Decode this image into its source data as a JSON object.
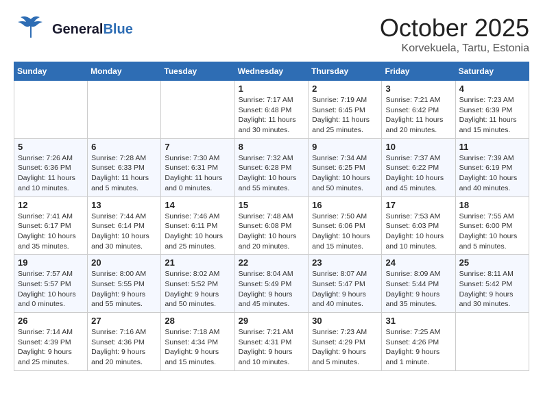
{
  "header": {
    "logo_general": "General",
    "logo_blue": "Blue",
    "month": "October 2025",
    "location": "Korvekuela, Tartu, Estonia"
  },
  "weekdays": [
    "Sunday",
    "Monday",
    "Tuesday",
    "Wednesday",
    "Thursday",
    "Friday",
    "Saturday"
  ],
  "weeks": [
    [
      {
        "day": "",
        "info": ""
      },
      {
        "day": "",
        "info": ""
      },
      {
        "day": "",
        "info": ""
      },
      {
        "day": "1",
        "info": "Sunrise: 7:17 AM\nSunset: 6:48 PM\nDaylight: 11 hours\nand 30 minutes."
      },
      {
        "day": "2",
        "info": "Sunrise: 7:19 AM\nSunset: 6:45 PM\nDaylight: 11 hours\nand 25 minutes."
      },
      {
        "day": "3",
        "info": "Sunrise: 7:21 AM\nSunset: 6:42 PM\nDaylight: 11 hours\nand 20 minutes."
      },
      {
        "day": "4",
        "info": "Sunrise: 7:23 AM\nSunset: 6:39 PM\nDaylight: 11 hours\nand 15 minutes."
      }
    ],
    [
      {
        "day": "5",
        "info": "Sunrise: 7:26 AM\nSunset: 6:36 PM\nDaylight: 11 hours\nand 10 minutes."
      },
      {
        "day": "6",
        "info": "Sunrise: 7:28 AM\nSunset: 6:33 PM\nDaylight: 11 hours\nand 5 minutes."
      },
      {
        "day": "7",
        "info": "Sunrise: 7:30 AM\nSunset: 6:31 PM\nDaylight: 11 hours\nand 0 minutes."
      },
      {
        "day": "8",
        "info": "Sunrise: 7:32 AM\nSunset: 6:28 PM\nDaylight: 10 hours\nand 55 minutes."
      },
      {
        "day": "9",
        "info": "Sunrise: 7:34 AM\nSunset: 6:25 PM\nDaylight: 10 hours\nand 50 minutes."
      },
      {
        "day": "10",
        "info": "Sunrise: 7:37 AM\nSunset: 6:22 PM\nDaylight: 10 hours\nand 45 minutes."
      },
      {
        "day": "11",
        "info": "Sunrise: 7:39 AM\nSunset: 6:19 PM\nDaylight: 10 hours\nand 40 minutes."
      }
    ],
    [
      {
        "day": "12",
        "info": "Sunrise: 7:41 AM\nSunset: 6:17 PM\nDaylight: 10 hours\nand 35 minutes."
      },
      {
        "day": "13",
        "info": "Sunrise: 7:44 AM\nSunset: 6:14 PM\nDaylight: 10 hours\nand 30 minutes."
      },
      {
        "day": "14",
        "info": "Sunrise: 7:46 AM\nSunset: 6:11 PM\nDaylight: 10 hours\nand 25 minutes."
      },
      {
        "day": "15",
        "info": "Sunrise: 7:48 AM\nSunset: 6:08 PM\nDaylight: 10 hours\nand 20 minutes."
      },
      {
        "day": "16",
        "info": "Sunrise: 7:50 AM\nSunset: 6:06 PM\nDaylight: 10 hours\nand 15 minutes."
      },
      {
        "day": "17",
        "info": "Sunrise: 7:53 AM\nSunset: 6:03 PM\nDaylight: 10 hours\nand 10 minutes."
      },
      {
        "day": "18",
        "info": "Sunrise: 7:55 AM\nSunset: 6:00 PM\nDaylight: 10 hours\nand 5 minutes."
      }
    ],
    [
      {
        "day": "19",
        "info": "Sunrise: 7:57 AM\nSunset: 5:57 PM\nDaylight: 10 hours\nand 0 minutes."
      },
      {
        "day": "20",
        "info": "Sunrise: 8:00 AM\nSunset: 5:55 PM\nDaylight: 9 hours\nand 55 minutes."
      },
      {
        "day": "21",
        "info": "Sunrise: 8:02 AM\nSunset: 5:52 PM\nDaylight: 9 hours\nand 50 minutes."
      },
      {
        "day": "22",
        "info": "Sunrise: 8:04 AM\nSunset: 5:49 PM\nDaylight: 9 hours\nand 45 minutes."
      },
      {
        "day": "23",
        "info": "Sunrise: 8:07 AM\nSunset: 5:47 PM\nDaylight: 9 hours\nand 40 minutes."
      },
      {
        "day": "24",
        "info": "Sunrise: 8:09 AM\nSunset: 5:44 PM\nDaylight: 9 hours\nand 35 minutes."
      },
      {
        "day": "25",
        "info": "Sunrise: 8:11 AM\nSunset: 5:42 PM\nDaylight: 9 hours\nand 30 minutes."
      }
    ],
    [
      {
        "day": "26",
        "info": "Sunrise: 7:14 AM\nSunset: 4:39 PM\nDaylight: 9 hours\nand 25 minutes."
      },
      {
        "day": "27",
        "info": "Sunrise: 7:16 AM\nSunset: 4:36 PM\nDaylight: 9 hours\nand 20 minutes."
      },
      {
        "day": "28",
        "info": "Sunrise: 7:18 AM\nSunset: 4:34 PM\nDaylight: 9 hours\nand 15 minutes."
      },
      {
        "day": "29",
        "info": "Sunrise: 7:21 AM\nSunset: 4:31 PM\nDaylight: 9 hours\nand 10 minutes."
      },
      {
        "day": "30",
        "info": "Sunrise: 7:23 AM\nSunset: 4:29 PM\nDaylight: 9 hours\nand 5 minutes."
      },
      {
        "day": "31",
        "info": "Sunrise: 7:25 AM\nSunset: 4:26 PM\nDaylight: 9 hours\nand 1 minute."
      },
      {
        "day": "",
        "info": ""
      }
    ]
  ]
}
